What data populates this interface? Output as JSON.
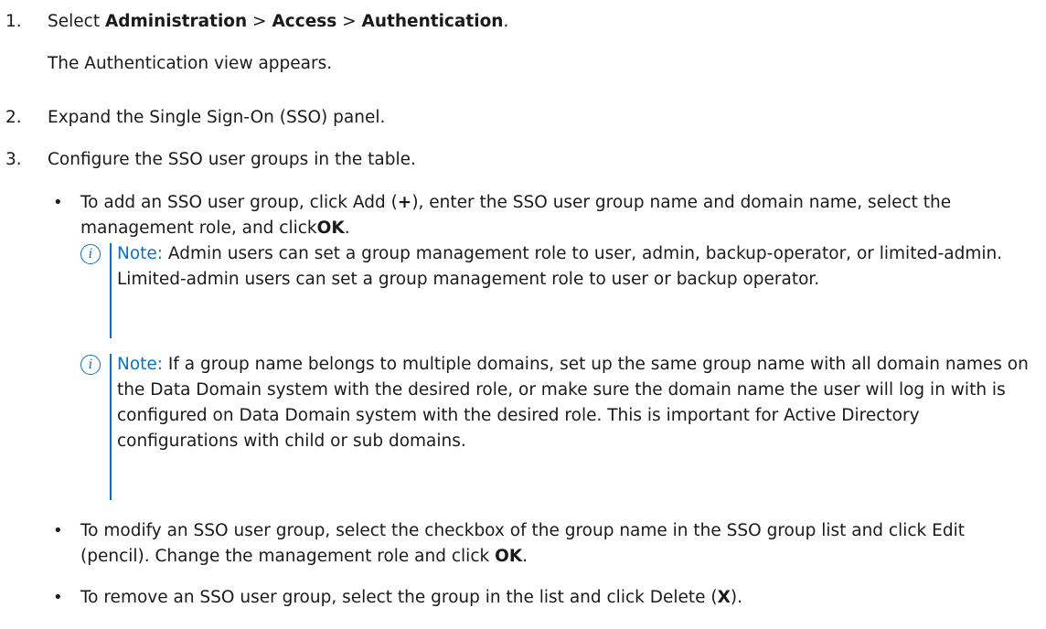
{
  "steps": [
    {
      "number": "1.",
      "prefix": "Select ",
      "path_part1": "Administration",
      "sep1": " > ",
      "path_part2": "Access",
      "sep2": " > ",
      "path_part3": "Authentication",
      "suffix": ".",
      "result": "The Authentication view appears."
    },
    {
      "number": "2.",
      "text": "Expand the Single Sign-On (SSO) panel."
    },
    {
      "number": "3.",
      "text": "Configure the SSO user groups in the table.",
      "bullets": [
        {
          "text_a": "To add an SSO user group, click Add (",
          "symbol": "+",
          "text_b": "), enter the SSO user group name and domain name, select the management role, and click",
          "action": "OK",
          "end": "."
        },
        {
          "text_a": "To modify an SSO user group, select the checkbox of the group name in the SSO group list and click Edit (pencil). Change the management role and click ",
          "action": "OK",
          "end": "."
        },
        {
          "text_a": "To remove an SSO user group, select the group in the list and click Delete (",
          "symbol": "X",
          "end": ")."
        }
      ]
    }
  ],
  "notes": [
    {
      "icon": "info-icon",
      "icon_glyph": "i",
      "label": "Note:",
      "text": " Admin users can set a group management role to user, admin, backup-operator, or limited-admin. Limited-admin users can set a group management role to user or backup operator."
    },
    {
      "icon": "info-icon",
      "icon_glyph": "i",
      "label": "Note:",
      "text": " If a group name belongs to multiple domains, set up the same group name with all domain names on the Data Domain system with the desired role, or make sure the domain name the user will log in with is configured on Data Domain system with the desired role. This is important for Active Directory configurations with child or sub domains."
    }
  ],
  "colors": {
    "accent": "#0672cb",
    "text": "#1a1a1a"
  },
  "bullet_glyph": "•"
}
